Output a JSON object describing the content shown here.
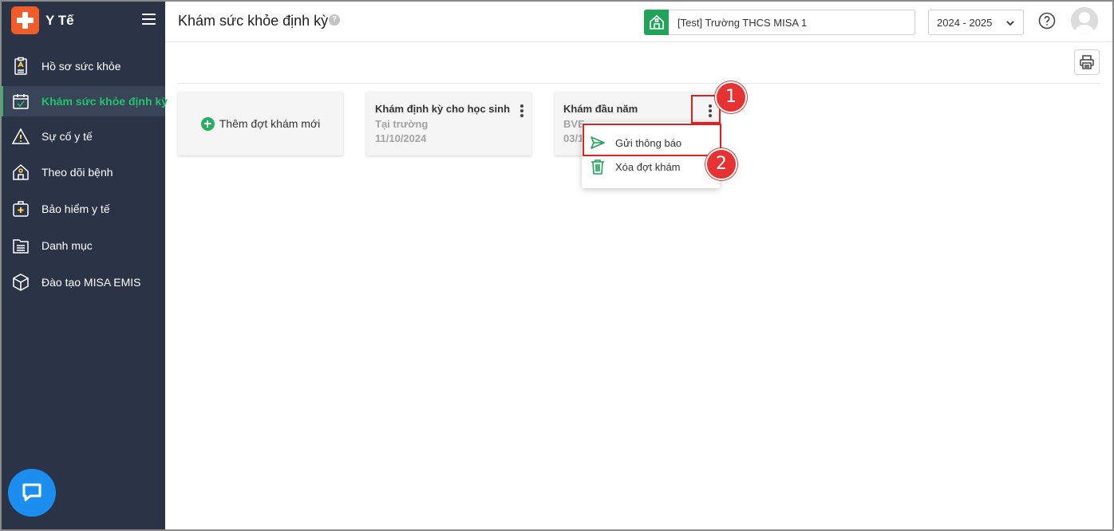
{
  "app": {
    "title": "Y Tế"
  },
  "sidebar": {
    "items": [
      {
        "label": "Hồ sơ sức khỏe",
        "icon": "health-record-icon",
        "active": false
      },
      {
        "label": "Khám sức khỏe định kỳ",
        "icon": "calendar-check-icon",
        "active": true
      },
      {
        "label": "Sự cố y tế",
        "icon": "warning-icon",
        "active": false
      },
      {
        "label": "Theo dõi bệnh",
        "icon": "home-tracking-icon",
        "active": false
      },
      {
        "label": "Bảo hiểm y tế",
        "icon": "medical-bag-icon",
        "active": false
      },
      {
        "label": "Danh mục",
        "icon": "folder-icon",
        "active": false
      },
      {
        "label": "Đào tạo MISA EMIS",
        "icon": "box-icon",
        "active": false
      }
    ],
    "active_color": "#21c36b",
    "background": "#2b3446"
  },
  "header": {
    "page_title": "Khám sức khỏe định kỳ",
    "help_mark": "?",
    "school": "[Test] Trường THCS MISA 1",
    "year": "2024 - 2025"
  },
  "cards": {
    "add_label": "Thêm đợt khám mới",
    "items": [
      {
        "title": "Khám định kỳ cho học sinh",
        "location": "Tại trường",
        "date": "11/10/2024"
      },
      {
        "title": "Khám đầu năm",
        "location": "BVE",
        "date": "03/1"
      }
    ]
  },
  "context_menu": {
    "items": [
      {
        "label": "Gửi thông báo",
        "icon": "send-icon"
      },
      {
        "label": "Xóa đợt khám",
        "icon": "trash-icon"
      }
    ]
  },
  "annotations": {
    "step1": "1",
    "step2": "2",
    "color": "#e02020"
  }
}
